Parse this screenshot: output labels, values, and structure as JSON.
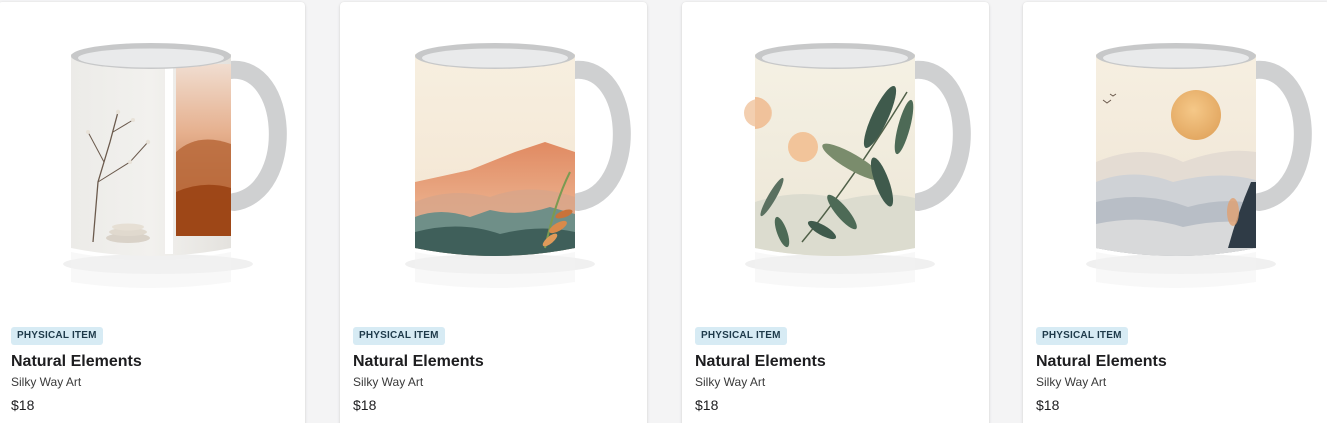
{
  "products": [
    {
      "badge": "PHYSICAL ITEM",
      "title": "Natural Elements",
      "artist": "Silky Way Art",
      "price": "$18",
      "image": "mug-minimal-branch-panels"
    },
    {
      "badge": "PHYSICAL ITEM",
      "title": "Natural Elements",
      "artist": "Silky Way Art",
      "price": "$18",
      "image": "mug-orange-mountain-landscape"
    },
    {
      "badge": "PHYSICAL ITEM",
      "title": "Natural Elements",
      "artist": "Silky Way Art",
      "price": "$18",
      "image": "mug-green-leaves-sun"
    },
    {
      "badge": "PHYSICAL ITEM",
      "title": "Natural Elements",
      "artist": "Silky Way Art",
      "price": "$18",
      "image": "mug-misty-hills-sun"
    }
  ],
  "colors": {
    "badge_bg": "#d7ebf4",
    "badge_text": "#1e3a4a",
    "card_bg": "#ffffff",
    "page_bg": "#f4f4f5"
  }
}
